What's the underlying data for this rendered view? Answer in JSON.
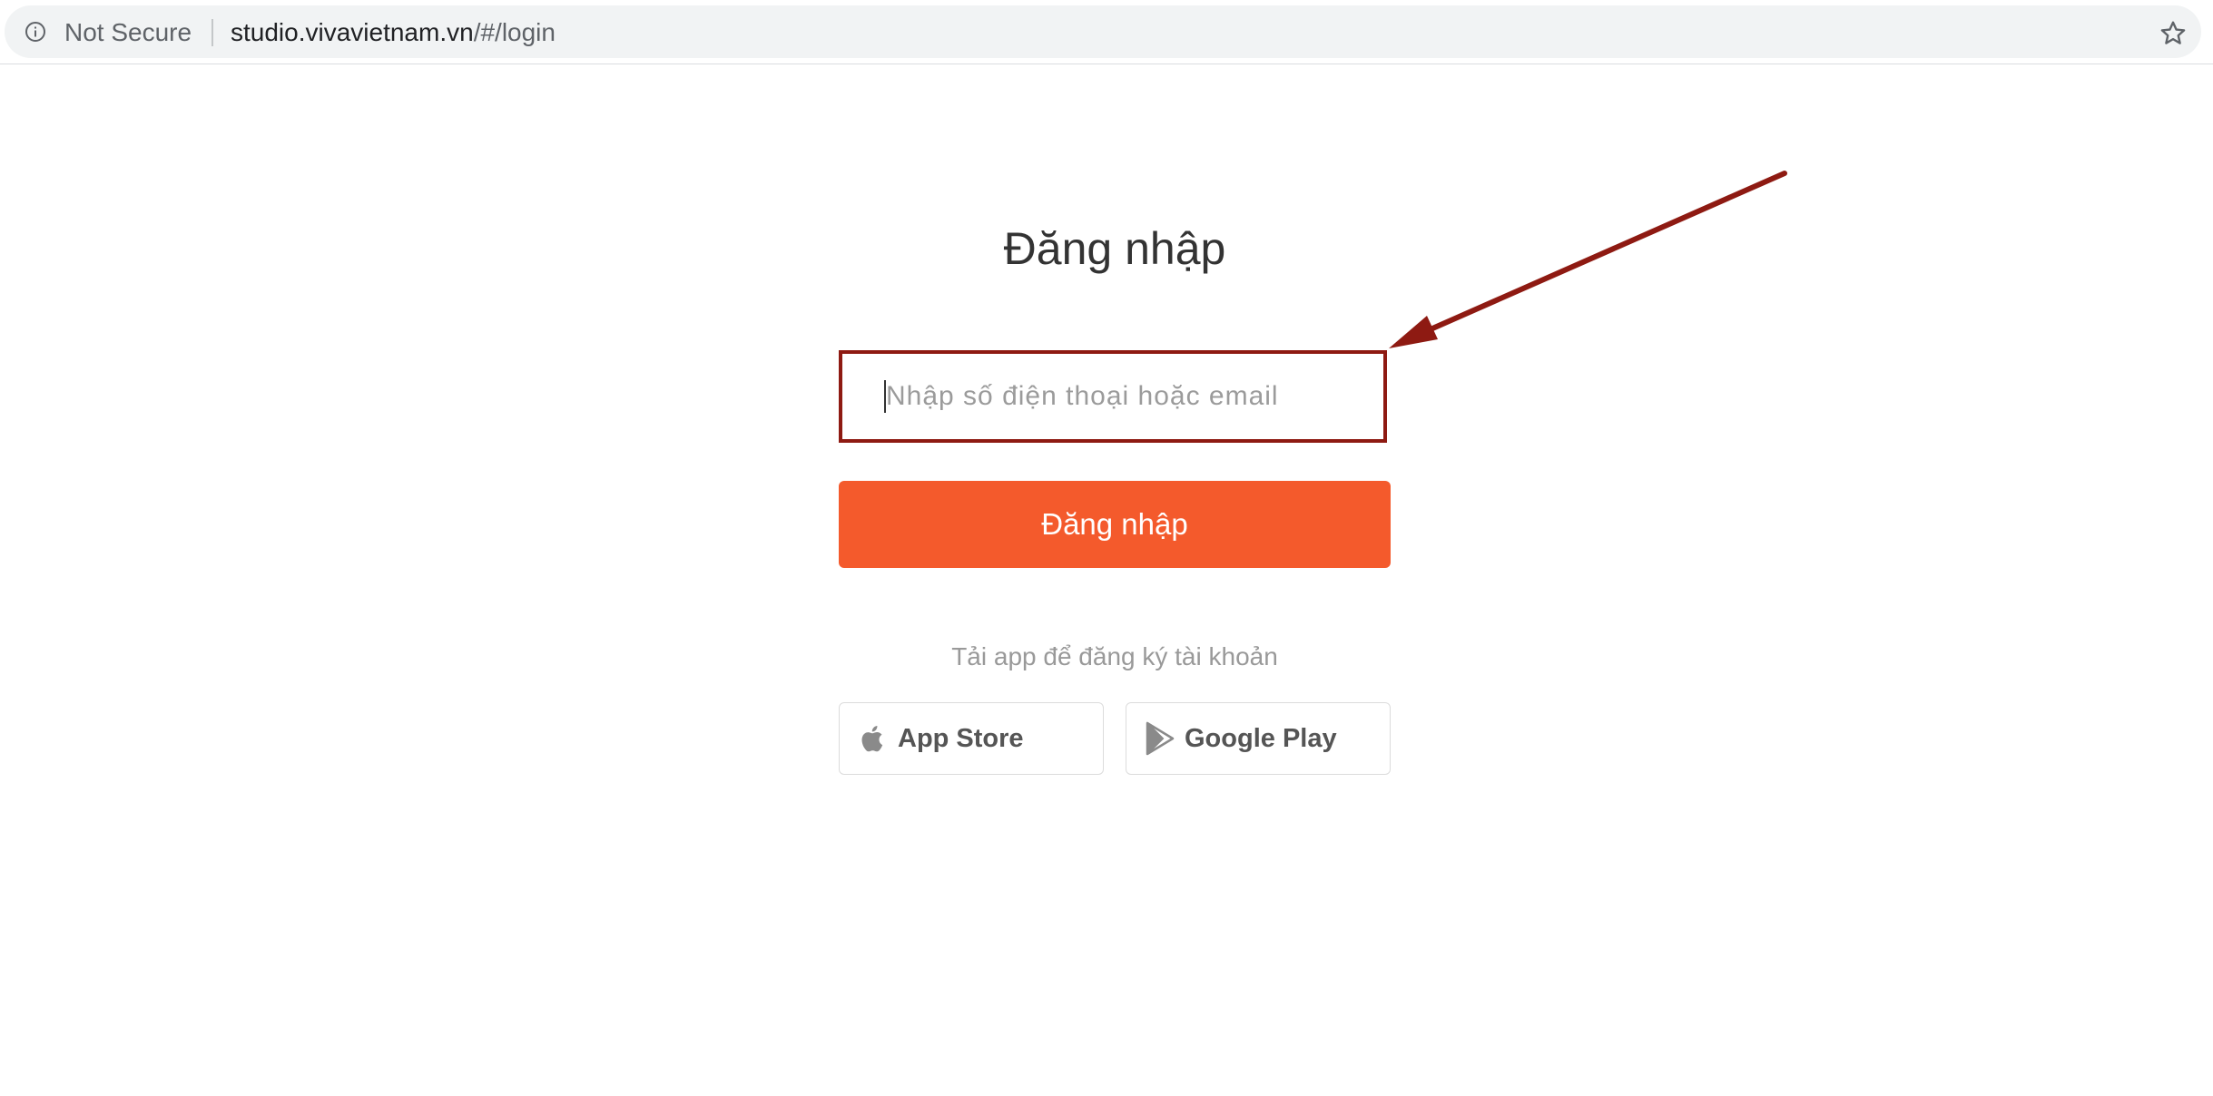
{
  "browser": {
    "security_label": "Not Secure",
    "url_host": "studio.vivavietnam.vn",
    "url_path": "/#/login",
    "icons": {
      "info": "info-icon",
      "bookmark": "star-icon"
    }
  },
  "login": {
    "title": "Đăng nhập",
    "input_placeholder": "Nhập số điện thoại hoặc email",
    "input_value": "",
    "submit_label": "Đăng nhập",
    "register_hint": "Tải app để đăng ký tài khoản"
  },
  "stores": {
    "app_store_label": "App Store",
    "google_play_label": "Google Play",
    "icons": {
      "app_store": "apple-icon",
      "google_play": "play-icon"
    }
  },
  "colors": {
    "accent": "#f45a2c",
    "annotation": "#8e1a12"
  }
}
